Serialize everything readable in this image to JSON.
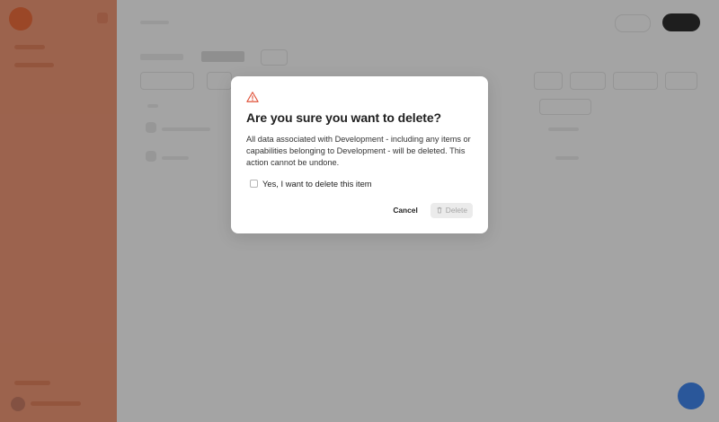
{
  "dialog": {
    "title": "Are you sure you want to delete?",
    "body": "All data associated with Development - including any items or capabilities belonging to Development - will be deleted. This action cannot be undone.",
    "confirm_label": "Yes, I want to delete this item",
    "confirm_checked": false,
    "cancel_label": "Cancel",
    "delete_label": "Delete",
    "delete_enabled": false,
    "icon": "warning-triangle-icon",
    "delete_icon": "trash-icon"
  },
  "colors": {
    "warning": "#e0533a",
    "sidebar": "#e99474",
    "fab": "#3f82e6"
  }
}
